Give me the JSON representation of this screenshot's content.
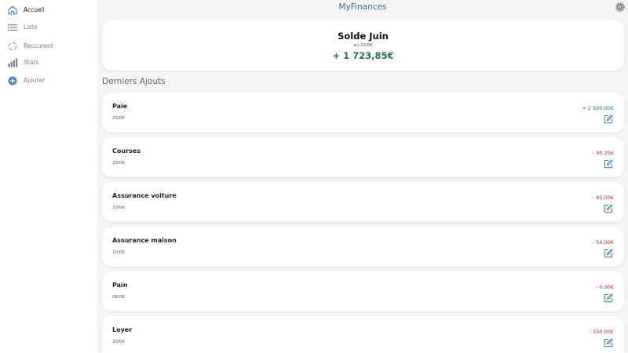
{
  "app": {
    "title": "MyFinances"
  },
  "sidebar": {
    "items": [
      {
        "label": "Accueil",
        "icon": "home-icon",
        "active": true
      },
      {
        "label": "Liste",
        "icon": "list-icon",
        "active": false
      },
      {
        "label": "Reccurent",
        "icon": "recurring-icon",
        "active": false
      },
      {
        "label": "Stats",
        "icon": "stats-icon",
        "active": false
      },
      {
        "label": "Ajouter",
        "icon": "add-icon",
        "active": false
      }
    ]
  },
  "header": {
    "settings_icon": "gear-icon"
  },
  "balance": {
    "title": "Solde Juin",
    "date": "au 20/06",
    "amount": "+ 1 723,85€"
  },
  "recent": {
    "title": "Derniers Ajouts",
    "entries": [
      {
        "label": "Paie",
        "date": "20/06",
        "amount": "+ 2 500,00€",
        "type": "income"
      },
      {
        "label": "Courses",
        "date": "20/06",
        "amount": "- 90,25€",
        "type": "expense"
      },
      {
        "label": "Assurance voiture",
        "date": "20/06",
        "amount": "- 85,00€",
        "type": "expense"
      },
      {
        "label": "Assurance maison",
        "date": "10/06",
        "amount": "- 50,00€",
        "type": "expense"
      },
      {
        "label": "Pain",
        "date": "08/06",
        "amount": "- 0,90€",
        "type": "expense"
      },
      {
        "label": "Loyer",
        "date": "20/06",
        "amount": "- 550,00€",
        "type": "expense"
      }
    ]
  },
  "colors": {
    "accent": "#2f6fa6",
    "income": "#1e7a45",
    "expense": "#c0282d",
    "background": "#f6f6f6",
    "card": "#ffffff"
  }
}
